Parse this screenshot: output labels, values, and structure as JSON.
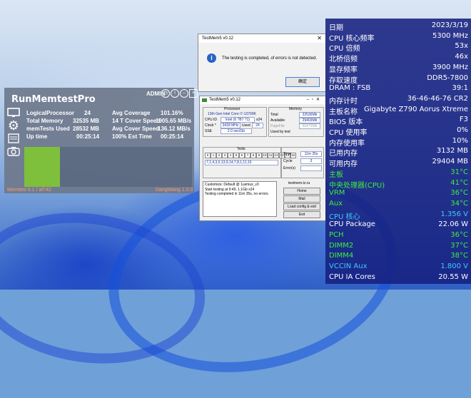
{
  "rmt": {
    "title": "RunMemtestPro",
    "admin": "ADMIN",
    "stats": [
      {
        "label": "LogicalProcessor",
        "value": "24"
      },
      {
        "label": "Total Memory",
        "value": "32535 MB"
      },
      {
        "label": "memTests Used",
        "value": "28532 MB"
      },
      {
        "label": "Up time",
        "value": "00:25:14"
      }
    ],
    "stats2": [
      {
        "label": "Avg Coverage",
        "value": "101.16%"
      },
      {
        "label": "14 T Cover Speed",
        "value": "1905.65 MB/s"
      },
      {
        "label": "Avg Cover Speed",
        "value": "136.12 MB/s"
      },
      {
        "label": "100% Est Time",
        "value": "00:25:14"
      }
    ],
    "footer_left": "Memtest 6.1 / af742",
    "footer_right": "DangWang 1.0.0"
  },
  "dialog": {
    "title": "TestMem5 v0.12",
    "message": "The testing is completed, of errors is not detected.",
    "ok_label": "确定"
  },
  "testmem": {
    "title": "TestMem5 v0.12",
    "processor_header": "Processor",
    "processor_name": "13th Gen Intel Core i7-13700K",
    "cpu_id_label": "CPU ID",
    "cpu_id": "Intel (6 ?B7 ?1)",
    "threads": "x24",
    "clock_label": "Clock *",
    "clock": "3418 MHz",
    "used_label": "Used",
    "used": "24",
    "sse_label": "SSE",
    "sse": "2.0 sec/Gb",
    "memory_header": "Memory",
    "total_label": "Total",
    "total": "32536Mb",
    "available_label": "Available",
    "available": "29403Mb",
    "pagefile_label": "PageFile",
    "pagefile": "60473Mb",
    "used_by_test_label": "Used by test",
    "tests_header": "Tests",
    "test_numbers": [
      "0",
      "1",
      "2",
      "3",
      "4",
      "5",
      "6",
      "7",
      "8",
      "9",
      "10",
      "11",
      "12",
      "13",
      "14",
      "15"
    ],
    "test_sequence": "7,1,4,3,0,13,9,14,7,8,1,11,15",
    "time_label": "Time",
    "time": "11m 35s",
    "cycle_label": "Cycle",
    "cycle": "3",
    "errors_label": "Error(s)",
    "errors": "",
    "log_lines": [
      "Customize: Default @ 1usmus_v3",
      "Start testing at 9:49, 1.1Gb x24",
      "Testing completed in 11m 35s, no errors."
    ],
    "site": "testmem.tz.ru",
    "btn_home": "Home",
    "btn_mail": "Mail",
    "btn_load": "Load config & exit",
    "btn_exit": "Exit"
  },
  "osd": {
    "rows": [
      {
        "label": "日期",
        "value": "2023/3/19",
        "color": "#ffffff"
      },
      {
        "label": "CPU 核心频率",
        "value": "5300 MHz",
        "color": "#ffffff"
      },
      {
        "label": "CPU 倍频",
        "value": "53x",
        "color": "#ffffff"
      },
      {
        "label": "北桥倍频",
        "value": "46x",
        "color": "#ffffff"
      },
      {
        "label": "显存频率",
        "value": "3900 MHz",
        "color": "#ffffff"
      },
      {
        "label": "存取速度",
        "value": "DDR5-7800",
        "color": "#ffffff"
      },
      {
        "label": "DRAM : FSB",
        "value": "39:1",
        "color": "#ffffff"
      },
      {
        "label": "内存计时",
        "value": "36-46-46-76 CR2",
        "color": "#ffffff"
      },
      {
        "label": "主板名称",
        "value": "Gigabyte Z790 Aorus Xtreme",
        "color": "#ffffff"
      },
      {
        "label": "BIOS 版本",
        "value": "F3",
        "color": "#ffffff"
      },
      {
        "label": "CPU 使用率",
        "value": "0%",
        "color": "#ffffff"
      },
      {
        "label": "内存使用率",
        "value": "10%",
        "color": "#ffffff"
      },
      {
        "label": "已用内存",
        "value": "3132 MB",
        "color": "#ffffff"
      },
      {
        "label": "可用内存",
        "value": "29404 MB",
        "color": "#ffffff"
      },
      {
        "label": "主板",
        "value": "31°C",
        "color": "#3cf03c"
      },
      {
        "label": "中央处理器(CPU)",
        "value": "41°C",
        "color": "#3cf03c"
      },
      {
        "label": "VRM",
        "value": "36°C",
        "color": "#3cf03c"
      },
      {
        "label": "Aux",
        "value": "34°C",
        "color": "#3cf03c"
      },
      {
        "label": "CPU 核心",
        "value": "1.356 V",
        "color": "#40c8ff"
      },
      {
        "label": "CPU Package",
        "value": "22.06 W",
        "color": "#ffffff"
      },
      {
        "label": "PCH",
        "value": "36°C",
        "color": "#3cf03c"
      },
      {
        "label": "DIMM2",
        "value": "37°C",
        "color": "#3cf03c"
      },
      {
        "label": "DIMM4",
        "value": "38°C",
        "color": "#3cf03c"
      },
      {
        "label": "VCCIN Aux",
        "value": "1.800 V",
        "color": "#40c8ff"
      },
      {
        "label": "CPU IA Cores",
        "value": "20.55 W",
        "color": "#ffffff"
      }
    ]
  }
}
